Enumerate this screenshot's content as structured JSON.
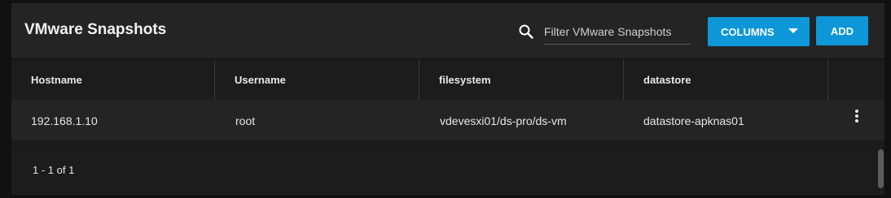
{
  "header": {
    "title": "VMware Snapshots",
    "filter_placeholder": "Filter VMware Snapshots",
    "columns_label": "COLUMNS",
    "add_label": "ADD"
  },
  "table": {
    "columns": [
      "Hostname",
      "Username",
      "filesystem",
      "datastore"
    ],
    "rows": [
      [
        "192.168.1.10",
        "root",
        "vdevesxi01/ds-pro/ds-vm",
        "datastore-apknas01"
      ]
    ]
  },
  "pagination": {
    "range": "1 - 1 of 1"
  },
  "colors": {
    "accent": "#0d97d9",
    "panel": "#242424",
    "background": "#111111"
  },
  "icons": {
    "search": "search-icon",
    "row_menu": "more-vert-icon",
    "dropdown": "caret-down-icon"
  }
}
